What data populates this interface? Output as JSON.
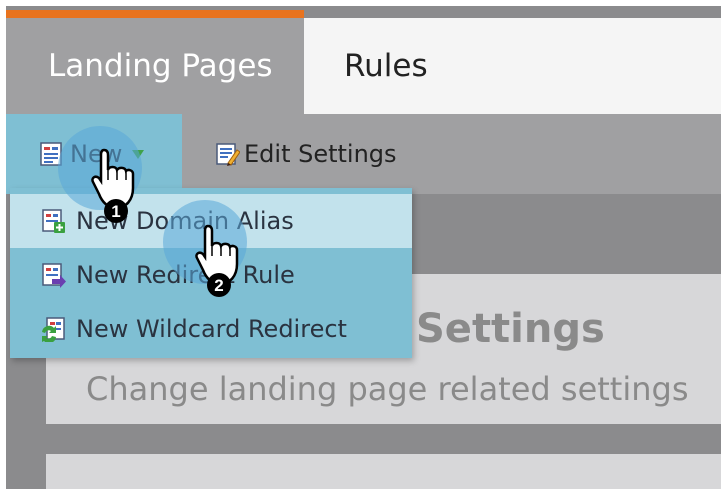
{
  "tabs": [
    {
      "label": "Landing Pages",
      "active": true
    },
    {
      "label": "Rules",
      "active": false
    }
  ],
  "toolbar": {
    "new_label": "New",
    "edit_settings_label": "Edit Settings"
  },
  "new_menu": {
    "items": [
      {
        "label": "New Domain Alias",
        "icon": "domain-alias-icon"
      },
      {
        "label": "New Redirect Rule",
        "icon": "redirect-rule-icon"
      },
      {
        "label": "New Wildcard Redirect",
        "icon": "wildcard-redirect-icon"
      }
    ]
  },
  "panel": {
    "title": "Settings",
    "subtitle": "Change landing page related settings"
  },
  "steps": [
    "1",
    "2"
  ],
  "colors": {
    "accent_orange": "#e8731e",
    "menu_blue": "#7fbfd3",
    "menu_highlight": "#c2e2ec",
    "toolbar_gray": "#a0a0a2",
    "background_gray": "#8b8b8d"
  }
}
